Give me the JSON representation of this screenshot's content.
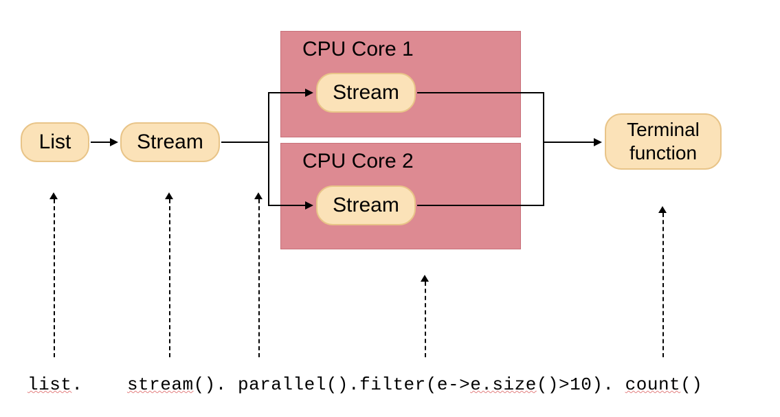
{
  "nodes": {
    "list": "List",
    "stream": "Stream",
    "stream_core1": "Stream",
    "stream_core2": "Stream",
    "terminal": "Terminal function"
  },
  "cpu": {
    "core1": "CPU Core 1",
    "core2": "CPU Core 2"
  },
  "code": {
    "seg_list": "list",
    "dot1": ". ",
    "seg_stream": "stream",
    "paren1": "(). ",
    "seg_parallel": "parallel",
    "paren2": "().",
    "seg_filter": "filter",
    "paren3": "(e->",
    "seg_esize": "e.size",
    "paren4": "()>10). ",
    "seg_count": "count",
    "paren5": "()"
  }
}
